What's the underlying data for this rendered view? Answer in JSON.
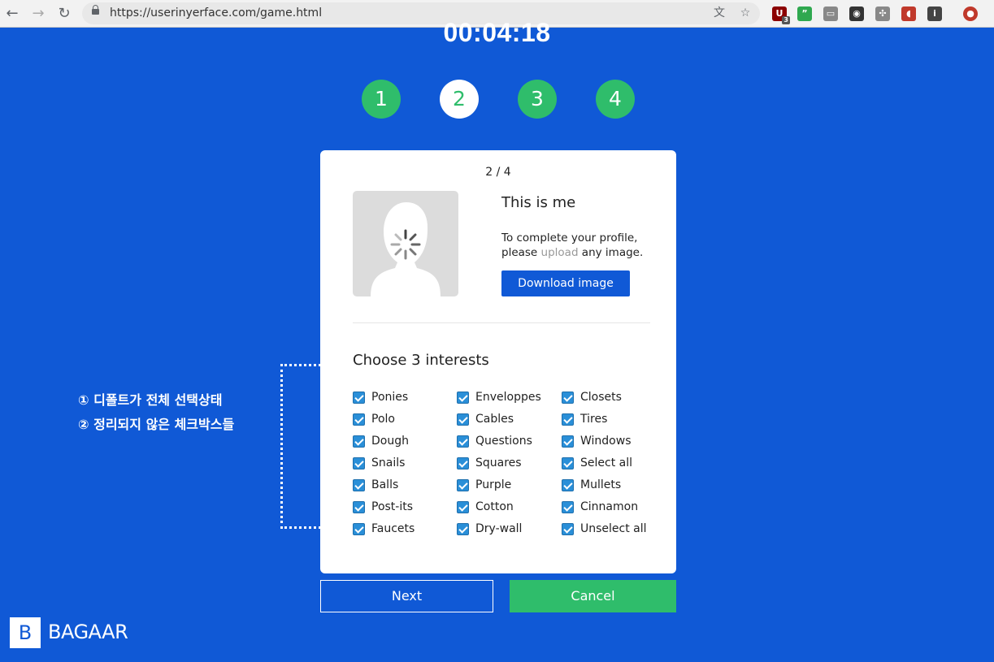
{
  "browser": {
    "url": "https://userinyerface.com/game.html",
    "back_icon": "←",
    "forward_icon": "→",
    "reload_icon": "↻",
    "translate_icon": "文",
    "star_icon": "☆",
    "extensions": [
      {
        "name": "ublock-icon",
        "glyph": "U",
        "color": "#8b0000",
        "badge": "3"
      },
      {
        "name": "hangouts-icon",
        "glyph": "”",
        "color": "#2fa84f"
      },
      {
        "name": "cast-icon",
        "glyph": "▭",
        "color": "#888888"
      },
      {
        "name": "camera-icon",
        "glyph": "◉",
        "color": "#333333"
      },
      {
        "name": "puzzle-icon",
        "glyph": "✣",
        "color": "#888888"
      },
      {
        "name": "record-icon",
        "glyph": "◖",
        "color": "#c0392b"
      },
      {
        "name": "info-ext-icon",
        "glyph": "i",
        "color": "#444444"
      },
      {
        "name": "profile-avatar",
        "glyph": "●",
        "color": "#c0392b"
      }
    ]
  },
  "timer": "00:04:18",
  "steps": [
    "1",
    "2",
    "3",
    "4"
  ],
  "active_step": "2",
  "card": {
    "counter": "2 / 4",
    "title": "This is me",
    "desc_line1": "To complete your profile,",
    "desc_line2_pre": "please ",
    "desc_link": "upload",
    "desc_line2_post": " any image.",
    "download_label": "Download image",
    "interests_title": "Choose 3 interests",
    "interests": [
      [
        "Ponies",
        "Polo",
        "Dough",
        "Snails",
        "Balls",
        "Post-its",
        "Faucets"
      ],
      [
        "Enveloppes",
        "Cables",
        "Questions",
        "Squares",
        "Purple",
        "Cotton",
        "Dry-wall"
      ],
      [
        "Closets",
        "Tires",
        "Windows",
        "Select all",
        "Mullets",
        "Cinnamon",
        "Unselect all"
      ]
    ]
  },
  "buttons": {
    "next": "Next",
    "cancel": "Cancel"
  },
  "annotation": {
    "line1": "① 디폴트가 전체 선택상태",
    "line2": "② 정리되지 않은 체크박스들"
  },
  "logo": {
    "mark": "B",
    "text": "BAGAAR"
  },
  "colors": {
    "background": "#1059d6",
    "green": "#2fbd6b",
    "checkbox": "#2a8fd8"
  }
}
